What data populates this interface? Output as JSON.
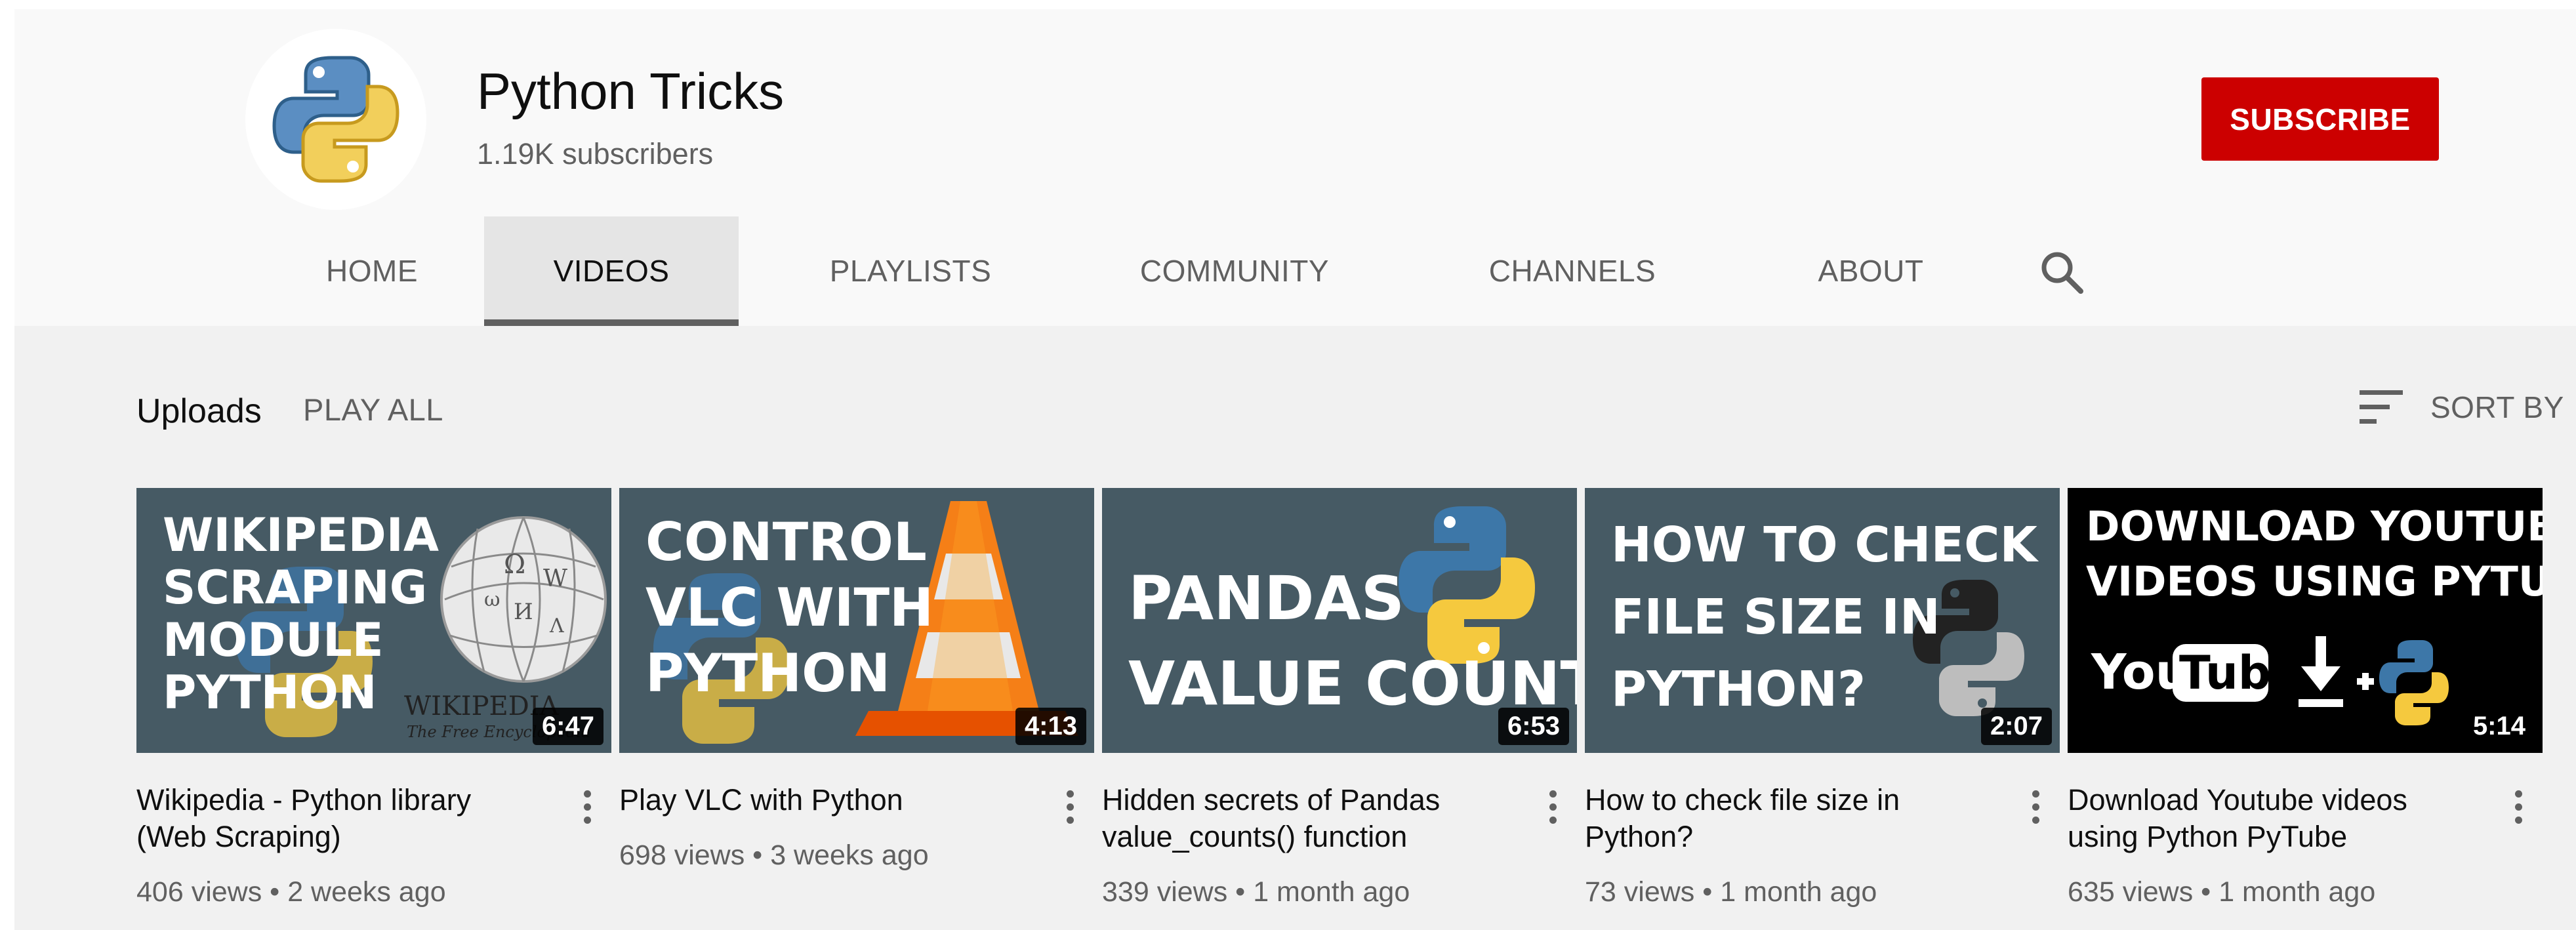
{
  "channel": {
    "name": "Python Tricks",
    "subscribers": "1.19K subscribers",
    "subscribe_label": "SUBSCRIBE"
  },
  "tabs": [
    {
      "label": "HOME"
    },
    {
      "label": "VIDEOS",
      "active": true
    },
    {
      "label": "PLAYLISTS"
    },
    {
      "label": "COMMUNITY"
    },
    {
      "label": "CHANNELS"
    },
    {
      "label": "ABOUT"
    }
  ],
  "section": {
    "title": "Uploads",
    "play_all": "PLAY ALL",
    "sort_by": "SORT BY"
  },
  "videos": [
    {
      "title": "Wikipedia - Python library (Web Scraping)",
      "views": "406 views",
      "age": "2 weeks ago",
      "duration": "6:47",
      "thumb_lines": [
        "WIKIPEDIA",
        "SCRAPING",
        "MODULE",
        "PYTHON"
      ],
      "thumb_logo_text": "WIKIPEDIA",
      "thumb_logo_sub": "The Free Encyclopedia"
    },
    {
      "title": "Play VLC with Python",
      "views": "698 views",
      "age": "3 weeks ago",
      "duration": "4:13",
      "thumb_lines": [
        "CONTROL",
        "VLC WITH",
        "PYTHON"
      ]
    },
    {
      "title": "Hidden secrets of Pandas value_counts() function",
      "views": "339 views",
      "age": "1 month ago",
      "duration": "6:53",
      "thumb_lines": [
        "PANDAS",
        "VALUE COUNTS"
      ]
    },
    {
      "title": "How to check file size in Python?",
      "views": "73 views",
      "age": "1 month ago",
      "duration": "2:07",
      "thumb_lines": [
        "HOW TO CHECK",
        "FILE SIZE IN",
        "PYTHON?"
      ]
    },
    {
      "title": "Download Youtube videos using Python PyTube",
      "views": "635 views",
      "age": "1 month ago",
      "duration": "5:14",
      "thumb_lines": [
        "DOWNLOAD YOUTUBE",
        "VIDEOS USING PYTUBE"
      ],
      "thumb_logo_text_1": "You",
      "thumb_logo_text_2": "Tube"
    }
  ],
  "meta_separator": "•",
  "colors": {
    "subscribe": "#cc0000",
    "thumb_slate": "#455a64",
    "python_blue": "#3d77a8",
    "python_yellow": "#f5c93e"
  },
  "icons": {
    "search": "search-icon",
    "sort": "sort-icon",
    "more": "more-vert-icon",
    "avatar": "python-logo-icon"
  }
}
